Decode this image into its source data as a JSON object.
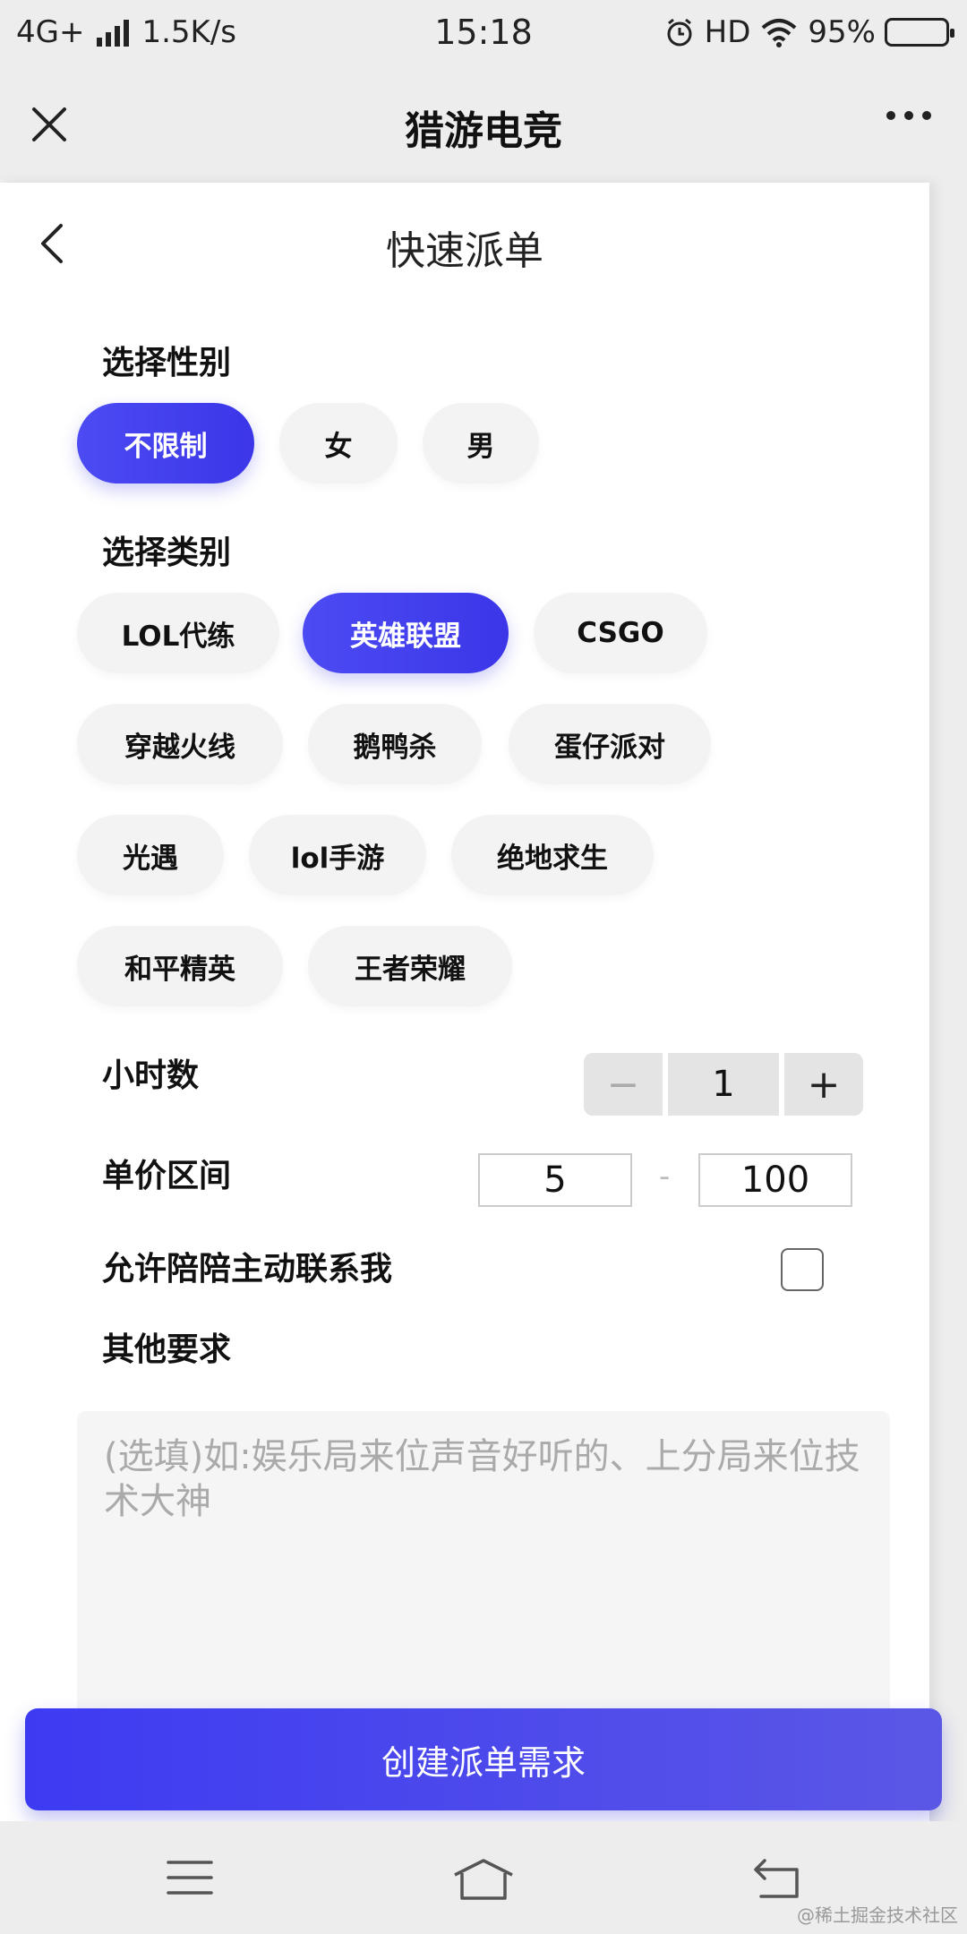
{
  "status_bar": {
    "network": "4G+",
    "speed": "1.5K/s",
    "time": "15:18",
    "hd": "HD",
    "battery_percent": "95%",
    "battery_level": 0.95
  },
  "title_bar": {
    "title": "猎游电竞",
    "close_icon": "close-icon",
    "more_icon": "more-icon"
  },
  "page": {
    "title": "快速派单",
    "back_icon": "chevron-left-icon"
  },
  "gender": {
    "label": "选择性别",
    "options": [
      "不限制",
      "女",
      "男"
    ],
    "selected": "不限制"
  },
  "category": {
    "label": "选择类别",
    "options": [
      "LOL代练",
      "英雄联盟",
      "CSGO",
      "穿越火线",
      "鹅鸭杀",
      "蛋仔派对",
      "光遇",
      "lol手游",
      "绝地求生",
      "和平精英",
      "王者荣耀"
    ],
    "selected": "英雄联盟"
  },
  "hours": {
    "label": "小时数",
    "value": "1",
    "minus": "−",
    "plus": "+"
  },
  "price": {
    "label": "单价区间",
    "min": "5",
    "separator": "-",
    "max": "100"
  },
  "allow_contact": {
    "label": "允许陪陪主动联系我",
    "checked": false
  },
  "requirements": {
    "label": "其他要求",
    "placeholder": "(选填)如:娱乐局来位声音好听的、上分局来位技术大神"
  },
  "submit": {
    "label": "创建派单需求"
  },
  "bottom_nav": {
    "menu_icon": "menu-icon",
    "home_icon": "home-icon",
    "back_icon": "back-icon"
  },
  "watermark": "@稀土掘金技术社区",
  "colors": {
    "accent": "#4040F0",
    "chip_bg": "#F3F3F3",
    "page_bg": "#EDEDED"
  }
}
